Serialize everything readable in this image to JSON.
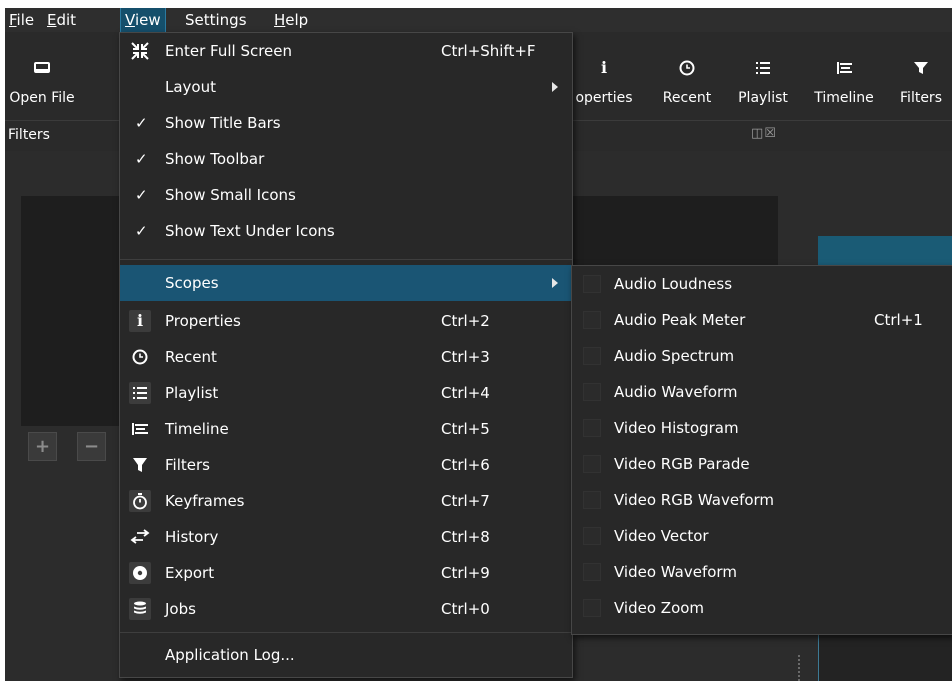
{
  "menubar": {
    "items": [
      {
        "label": "File",
        "mnemonic": "F",
        "rest": "ile"
      },
      {
        "label": "Edit",
        "mnemonic": "E",
        "rest": "dit"
      },
      {
        "label": "View",
        "mnemonic": "V",
        "rest": "iew"
      },
      {
        "label": "Settings",
        "mnemonic": "",
        "rest": "Settings"
      },
      {
        "label": "Help",
        "mnemonic": "H",
        "rest": "elp"
      }
    ]
  },
  "toolbar": {
    "open_file": "Open File",
    "properties": "operties",
    "recent": "Recent",
    "playlist": "Playlist",
    "timeline": "Timeline",
    "filters": "Filters"
  },
  "filters_panel": {
    "title": "Filters",
    "add_icon": "plus-icon",
    "remove_icon": "minus-icon"
  },
  "view_menu": {
    "items": [
      {
        "label": "Enter Full Screen",
        "shortcut": "Ctrl+Shift+F",
        "icon": "fullscreen-icon"
      },
      {
        "label": "Layout",
        "submenu": true
      },
      {
        "label": "Show Title Bars",
        "checked": true
      },
      {
        "label": "Show Toolbar",
        "checked": true
      },
      {
        "label": "Show Small Icons",
        "checked": true
      },
      {
        "label": "Show Text Under Icons",
        "checked": true
      },
      {
        "label": "Scopes",
        "submenu": true,
        "highlighted": true
      },
      {
        "label": "Properties",
        "shortcut": "Ctrl+2",
        "icon": "info-icon"
      },
      {
        "label": "Recent",
        "shortcut": "Ctrl+3",
        "icon": "clock-icon"
      },
      {
        "label": "Playlist",
        "shortcut": "Ctrl+4",
        "icon": "list-icon"
      },
      {
        "label": "Timeline",
        "shortcut": "Ctrl+5",
        "icon": "timeline-icon"
      },
      {
        "label": "Filters",
        "shortcut": "Ctrl+6",
        "icon": "funnel-icon"
      },
      {
        "label": "Keyframes",
        "shortcut": "Ctrl+7",
        "icon": "stopwatch-icon"
      },
      {
        "label": "History",
        "shortcut": "Ctrl+8",
        "icon": "history-icon"
      },
      {
        "label": "Export",
        "shortcut": "Ctrl+9",
        "icon": "disc-icon"
      },
      {
        "label": "Jobs",
        "shortcut": "Ctrl+0",
        "icon": "database-icon"
      },
      {
        "label": "Application Log..."
      }
    ]
  },
  "scopes_menu": {
    "items": [
      {
        "label": "Audio Loudness",
        "shortcut": "",
        "checked": false
      },
      {
        "label": "Audio Peak Meter",
        "shortcut": "Ctrl+1",
        "checked": false
      },
      {
        "label": "Audio Spectrum",
        "shortcut": "",
        "checked": false
      },
      {
        "label": "Audio Waveform",
        "shortcut": "",
        "checked": false
      },
      {
        "label": "Video Histogram",
        "shortcut": "",
        "checked": false
      },
      {
        "label": "Video RGB Parade",
        "shortcut": "",
        "checked": false
      },
      {
        "label": "Video RGB Waveform",
        "shortcut": "",
        "checked": false
      },
      {
        "label": "Video Vector",
        "shortcut": "",
        "checked": false
      },
      {
        "label": "Video Waveform",
        "shortcut": "",
        "checked": false
      },
      {
        "label": "Video Zoom",
        "shortcut": "",
        "checked": false
      }
    ]
  },
  "colors": {
    "menu_bg": "#282828",
    "highlight": "#1a5574",
    "app_bg": "#2f2f2f",
    "accent_strip": "#1a5b75"
  }
}
